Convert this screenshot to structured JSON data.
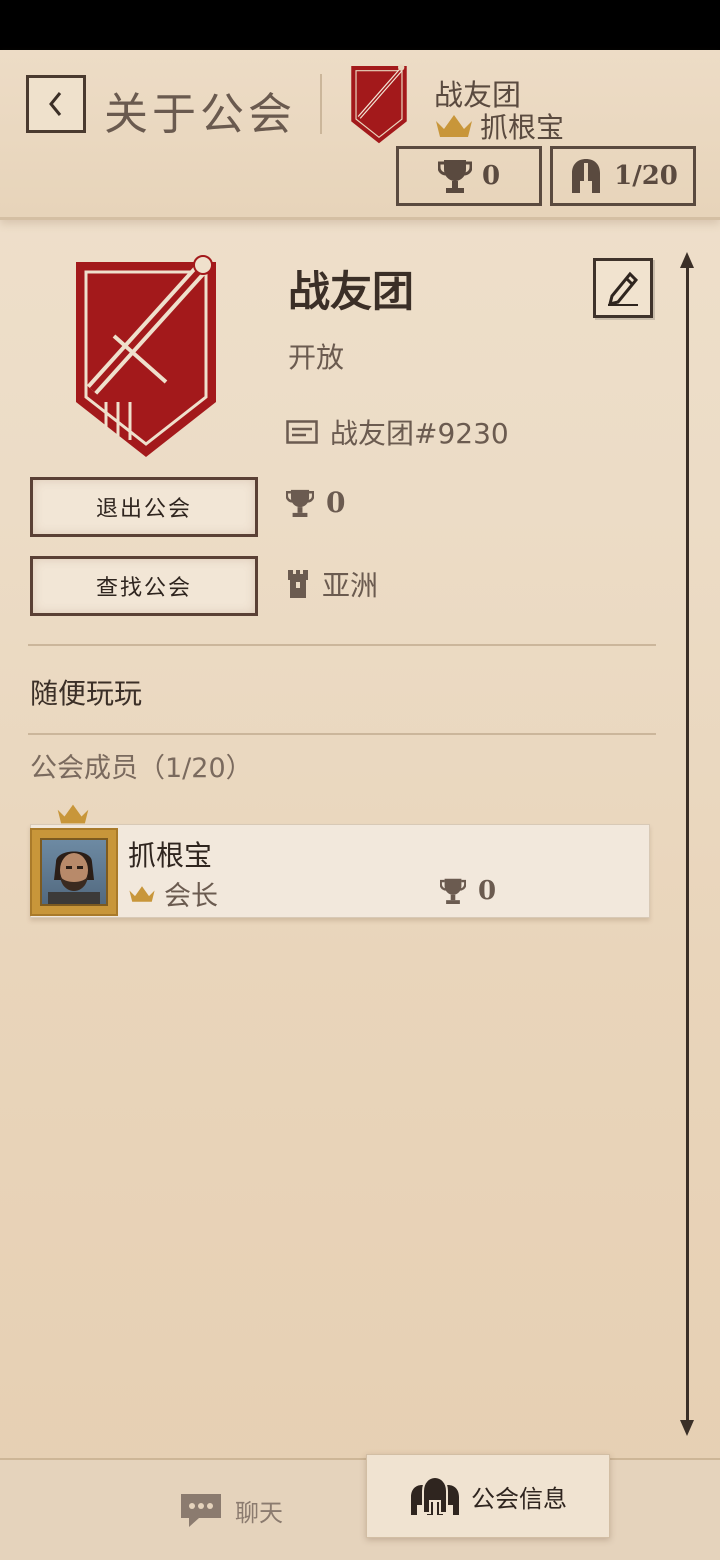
{
  "header": {
    "back_label": "<",
    "title": "关于公会",
    "guild_name": "战友团",
    "leader_name": "抓根宝",
    "trophy_count": "0",
    "member_count": "1/20"
  },
  "guild": {
    "name": "战友团",
    "status": "开放",
    "id_label": "战友团#9230",
    "trophies": "0",
    "region": "亚洲",
    "description": "随便玩玩"
  },
  "actions": {
    "leave": "退出公会",
    "find": "查找公会"
  },
  "members": {
    "heading": "公会成员（1/20）",
    "list": [
      {
        "name": "抓根宝",
        "role": "会长",
        "trophies": "0"
      }
    ]
  },
  "tabs": {
    "chat": "聊天",
    "guild_info": "公会信息"
  },
  "colors": {
    "accent_red": "#a3191b",
    "gold": "#c8963a",
    "parchment": "#ecdcc6",
    "text_dark": "#3b2f27"
  },
  "icons": {
    "back": "chevron-left-icon",
    "trophy": "trophy-icon",
    "members": "helmet-icon",
    "edit": "pencil-icon",
    "id": "id-card-icon",
    "region": "tower-icon",
    "crown": "crown-icon",
    "chat": "chat-bubble-icon",
    "guild_info": "helmets-icon"
  }
}
